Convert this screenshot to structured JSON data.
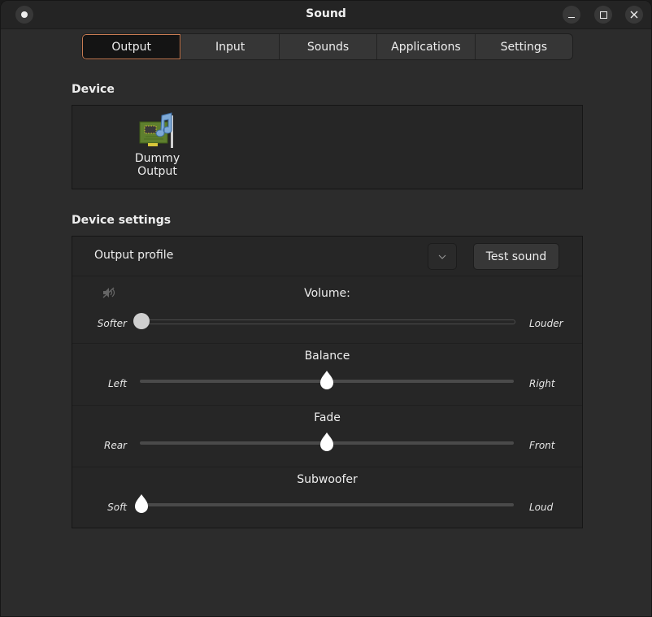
{
  "window": {
    "title": "Sound",
    "controls": [
      "menu",
      "minimize",
      "maximize",
      "close"
    ]
  },
  "tabs": [
    {
      "label": "Output",
      "active": true
    },
    {
      "label": "Input",
      "active": false
    },
    {
      "label": "Sounds",
      "active": false
    },
    {
      "label": "Applications",
      "active": false
    },
    {
      "label": "Settings",
      "active": false
    }
  ],
  "device": {
    "section_label": "Device",
    "items": [
      {
        "name": "Dummy Output",
        "icon": "sound-card-icon"
      }
    ]
  },
  "device_settings": {
    "section_label": "Device settings",
    "profile": {
      "label": "Output profile",
      "selected_value": "",
      "dropdown_icon": "chevron-down-icon"
    },
    "test_sound_label": "Test sound",
    "volume": {
      "heading": "Volume:",
      "min_label": "Softer",
      "max_label": "Louder",
      "value_fraction": 0.0,
      "muted_icon": "audio-volume-muted-icon"
    },
    "balance": {
      "heading": "Balance",
      "min_label": "Left",
      "max_label": "Right",
      "value_fraction": 0.5
    },
    "fade": {
      "heading": "Fade",
      "min_label": "Rear",
      "max_label": "Front",
      "value_fraction": 0.5
    },
    "subwoofer": {
      "heading": "Subwoofer",
      "min_label": "Soft",
      "max_label": "Loud",
      "value_fraction": 0.0
    }
  },
  "colors": {
    "accent": "#c87c53",
    "window_bg": "#2c2c2c",
    "frame_bg": "#262626",
    "titlebar_bg": "#242424"
  }
}
